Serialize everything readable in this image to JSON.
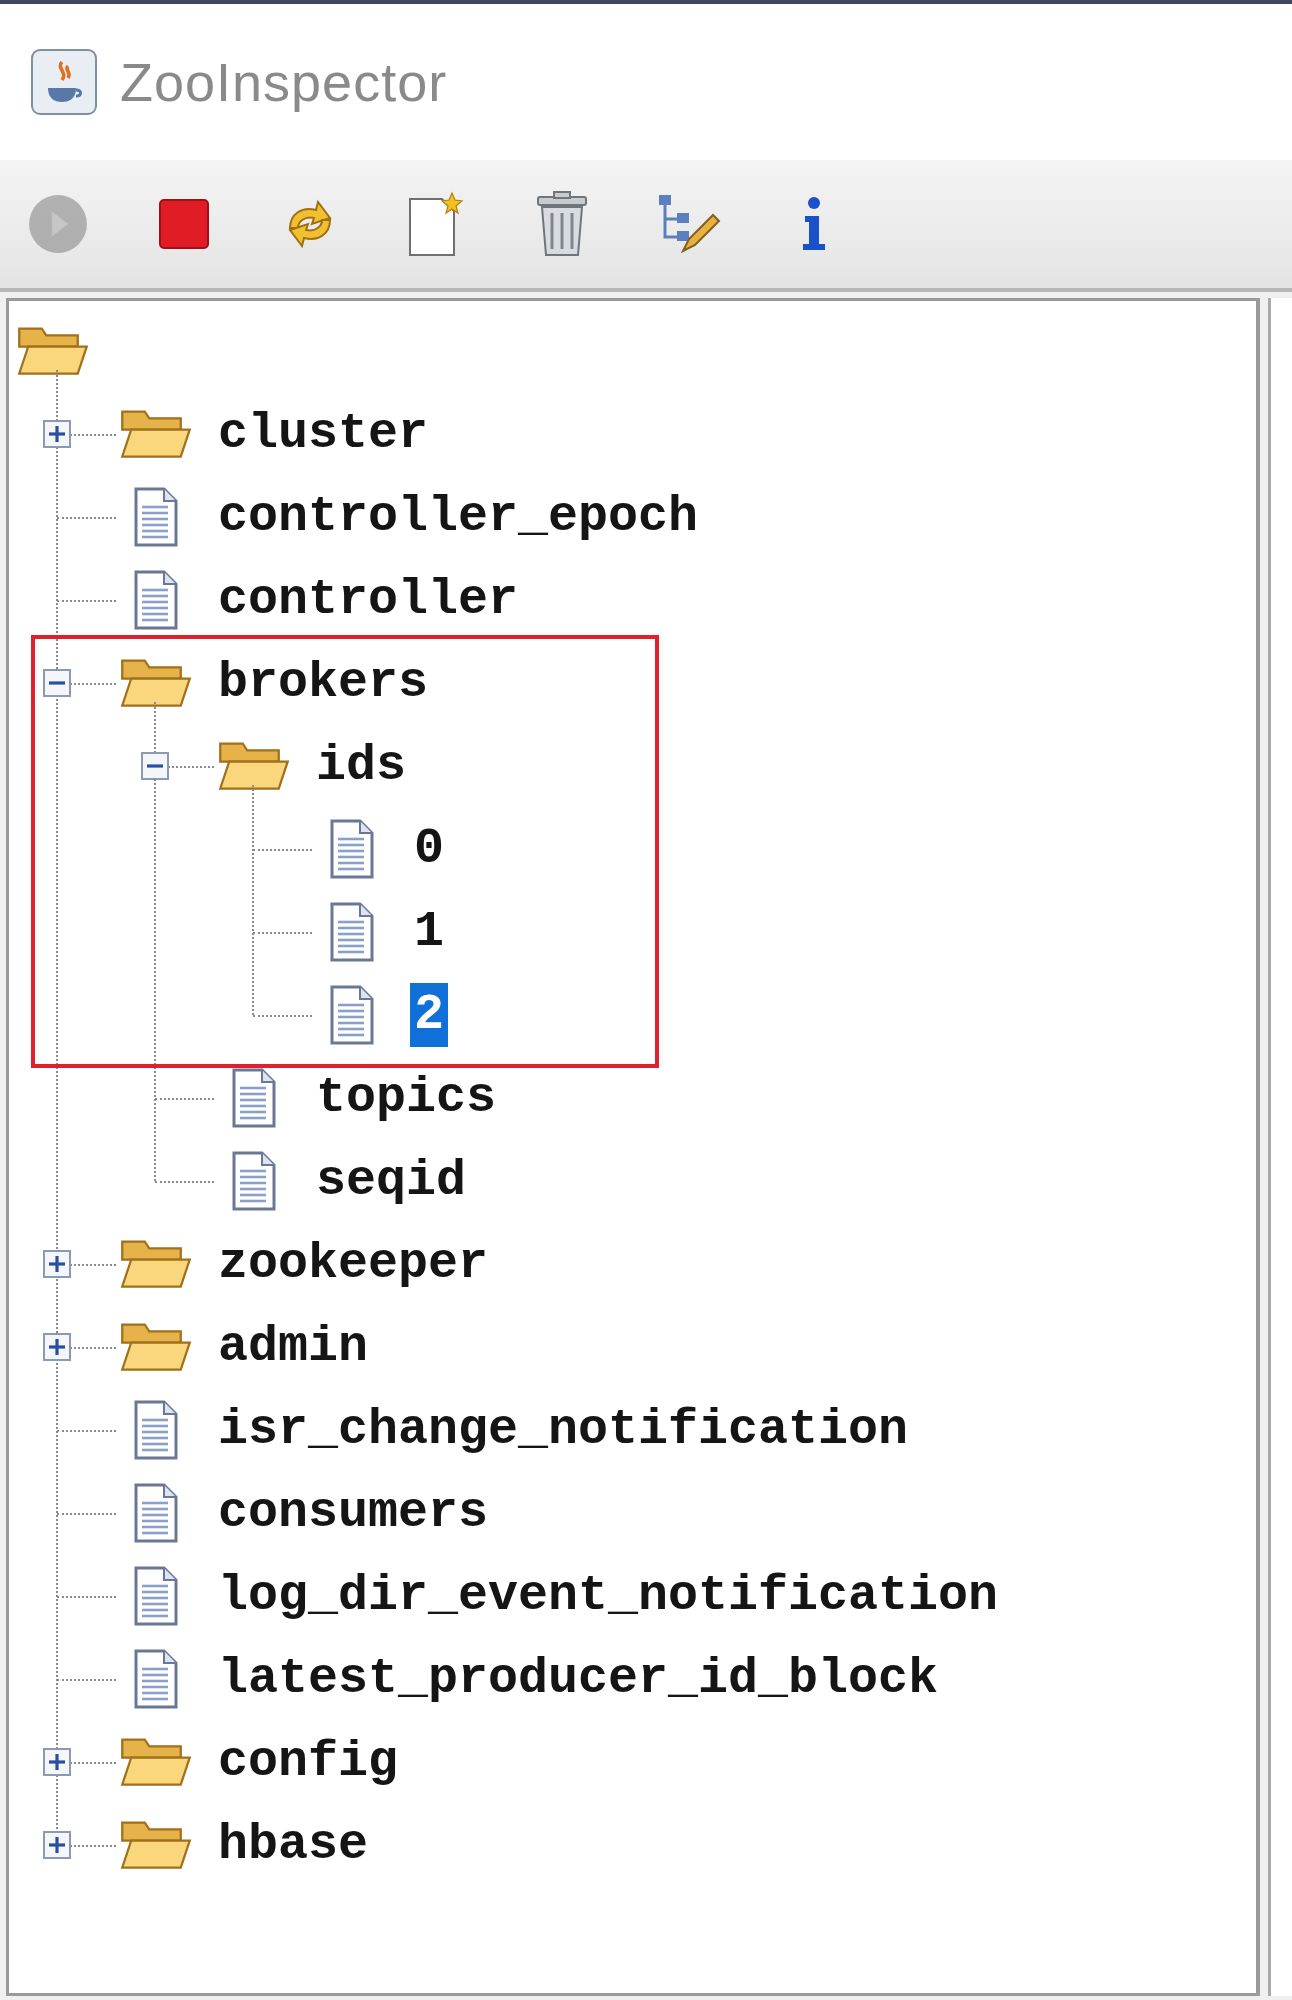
{
  "window": {
    "title": "ZooInspector"
  },
  "toolbar": [
    {
      "kind": "connect",
      "disabled": true
    },
    {
      "kind": "disconnect",
      "disabled": false
    },
    {
      "kind": "refresh",
      "disabled": false
    },
    {
      "kind": "add_node",
      "disabled": false
    },
    {
      "kind": "delete_node",
      "disabled": false
    },
    {
      "kind": "edit_nodes",
      "disabled": false
    },
    {
      "kind": "about",
      "disabled": false
    }
  ],
  "tree": {
    "root": {
      "kind": "folder",
      "children": [
        {
          "label": "cluster",
          "kind": "folder",
          "expanded": false,
          "selected": false
        },
        {
          "label": "controller_epoch",
          "kind": "file",
          "selected": false
        },
        {
          "label": "controller",
          "kind": "file",
          "selected": false
        },
        {
          "label": "brokers",
          "kind": "folder",
          "expanded": true,
          "selected": false,
          "highlighted": true,
          "children": [
            {
              "label": "ids",
              "kind": "folder",
              "expanded": true,
              "selected": false,
              "highlighted": true,
              "children": [
                {
                  "label": "0",
                  "kind": "file",
                  "selected": false,
                  "highlighted": true
                },
                {
                  "label": "1",
                  "kind": "file",
                  "selected": false,
                  "highlighted": true
                },
                {
                  "label": "2",
                  "kind": "file",
                  "selected": true,
                  "highlighted": true
                }
              ]
            },
            {
              "label": "topics",
              "kind": "file",
              "selected": false
            },
            {
              "label": "seqid",
              "kind": "file",
              "selected": false
            }
          ]
        },
        {
          "label": "zookeeper",
          "kind": "folder",
          "expanded": false,
          "selected": false
        },
        {
          "label": "admin",
          "kind": "folder",
          "expanded": false,
          "selected": false
        },
        {
          "label": "isr_change_notification",
          "kind": "file",
          "selected": false
        },
        {
          "label": "consumers",
          "kind": "file",
          "selected": false
        },
        {
          "label": "log_dir_event_notification",
          "kind": "file",
          "selected": false
        },
        {
          "label": "latest_producer_id_block",
          "kind": "file",
          "selected": false
        },
        {
          "label": "config",
          "kind": "folder",
          "expanded": false,
          "selected": false
        },
        {
          "label": "hbase",
          "kind": "folder",
          "expanded": false,
          "selected": false
        }
      ]
    }
  }
}
